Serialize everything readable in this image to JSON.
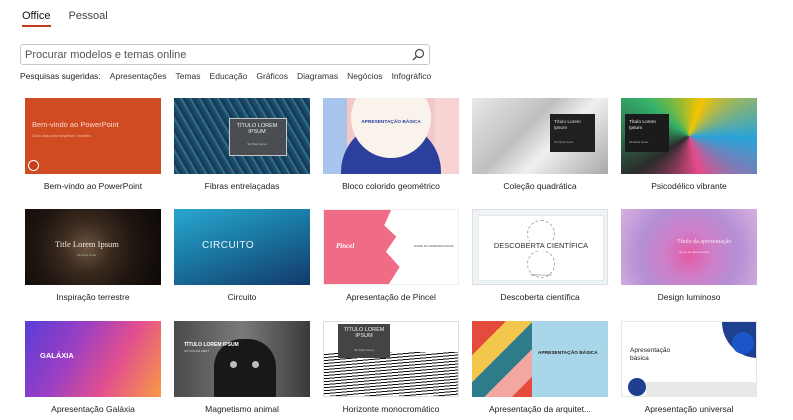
{
  "tabs": [
    {
      "label": "Office"
    },
    {
      "label": "Pessoal"
    }
  ],
  "search": {
    "placeholder": "Procurar modelos e temas online"
  },
  "suggestions": {
    "label": "Pesquisas sugeridas:",
    "items": [
      "Apresentações",
      "Temas",
      "Educação",
      "Gráficos",
      "Diagramas",
      "Negócios",
      "Infográfico"
    ]
  },
  "templates": [
    {
      "name": "Bem-vindo ao PowerPoint",
      "thumb_title": "Bem-vindo ao PowerPoint",
      "thumb_sub": "Cinco dicas para simplificar o trabalho"
    },
    {
      "name": "Fibras entrelaçadas",
      "thumb_title": "TÍTULO LOREM IPSUM",
      "thumb_sub": "Sit Dolor Amet"
    },
    {
      "name": "Bloco colorido geométrico",
      "thumb_title": "APRESENTAÇÃO BÁSICA"
    },
    {
      "name": "Coleção quadrática",
      "thumb_title": "Título Lorem Ipsum",
      "thumb_sub": "Sit Dolor Amet"
    },
    {
      "name": "Psicodélico vibrante",
      "thumb_title": "Título Lorem Ipsum",
      "thumb_sub": "Sit Dolor Amet"
    },
    {
      "name": "Inspiração terrestre",
      "thumb_title": "Title Lorem Ipsum",
      "thumb_sub": "Sit Dolor Amet"
    },
    {
      "name": "Circuito",
      "thumb_title": "CIRCUITO"
    },
    {
      "name": "Apresentação de Pincel",
      "thumb_title": "Pincel",
      "thumb_sub": "NOME DO APRESENTADOR"
    },
    {
      "name": "Descoberta científica",
      "thumb_title": "DESCOBERTA CIENTÍFICA",
      "thumb_sub": "SUBTÍTULO AQUI"
    },
    {
      "name": "Design luminoso",
      "thumb_title": "Título da apresentação",
      "thumb_sub": "Nome do apresentador"
    },
    {
      "name": "Apresentação Galáxia",
      "thumb_title": "GALÁXIA"
    },
    {
      "name": "Magnetismo animal",
      "thumb_title": "TÍTULO LOREM IPSUM",
      "thumb_sub": "SIT DOLOR AMET"
    },
    {
      "name": "Horizonte monocromático",
      "thumb_title": "TÍTULO LOREM IPSUM",
      "thumb_sub": "Sit Dolor Amet"
    },
    {
      "name": "Apresentação da arquitet...",
      "thumb_title": "APRESENTAÇÃO BÁSICA"
    },
    {
      "name": "Apresentação universal",
      "thumb_title": "Apresentação básica"
    }
  ],
  "colors": {
    "accent": "#c43e1c"
  }
}
